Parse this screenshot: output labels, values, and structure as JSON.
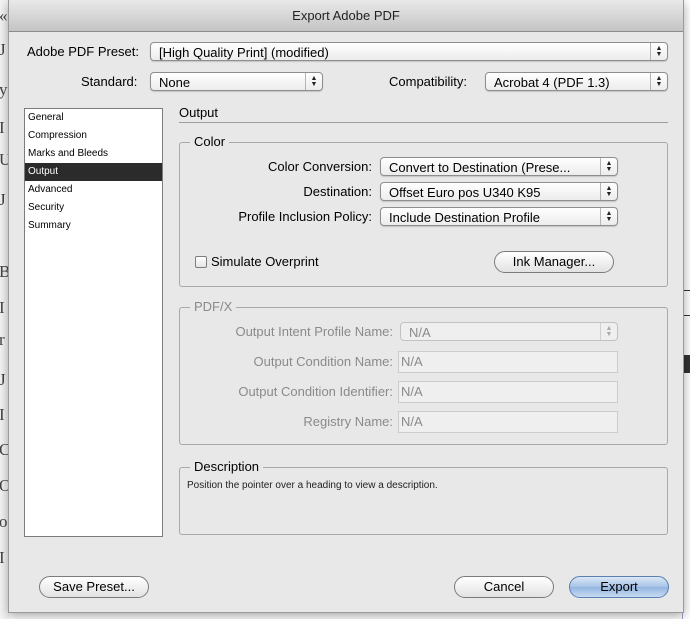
{
  "dialog": {
    "title": "Export Adobe PDF"
  },
  "preset": {
    "label": "Adobe PDF Preset:",
    "value": "[High Quality Print] (modified)"
  },
  "standard": {
    "label": "Standard:",
    "value": "None"
  },
  "compatibility": {
    "label": "Compatibility:",
    "value": "Acrobat 4 (PDF 1.3)"
  },
  "sidebar": {
    "items": [
      {
        "label": "General"
      },
      {
        "label": "Compression"
      },
      {
        "label": "Marks and Bleeds"
      },
      {
        "label": "Output"
      },
      {
        "label": "Advanced"
      },
      {
        "label": "Security"
      },
      {
        "label": "Summary"
      }
    ],
    "selected": "Output"
  },
  "output": {
    "title": "Output",
    "color": {
      "title": "Color",
      "conversion_label": "Color Conversion:",
      "conversion_value": "Convert to Destination (Prese...",
      "destination_label": "Destination:",
      "destination_value": "Offset Euro pos U340 K95",
      "policy_label": "Profile Inclusion Policy:",
      "policy_value": "Include Destination Profile",
      "simulate_label": "Simulate Overprint",
      "simulate_checked": false,
      "ink_manager_label": "Ink Manager..."
    },
    "pdfx": {
      "title": "PDF/X",
      "intent_label": "Output Intent Profile Name:",
      "intent_value": "N/A",
      "condition_name_label": "Output Condition Name:",
      "condition_name_value": "N/A",
      "condition_id_label": "Output Condition Identifier:",
      "condition_id_value": "N/A",
      "registry_label": "Registry Name:",
      "registry_value": "N/A"
    },
    "description": {
      "title": "Description",
      "text": "Position the pointer over a heading to view a description."
    }
  },
  "buttons": {
    "save_preset": "Save Preset...",
    "cancel": "Cancel",
    "export": "Export"
  },
  "background": {
    "left_glyphs": [
      "«",
      "J",
      "y",
      "I",
      "U",
      "J",
      "B",
      "I",
      "r",
      "J",
      "I",
      "C",
      "O",
      "o",
      "I"
    ]
  }
}
